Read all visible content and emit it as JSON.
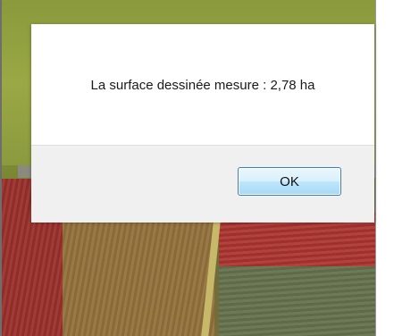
{
  "dialog": {
    "message": "La surface dessinée mesure : 2,78 ha",
    "ok_label": "OK"
  }
}
